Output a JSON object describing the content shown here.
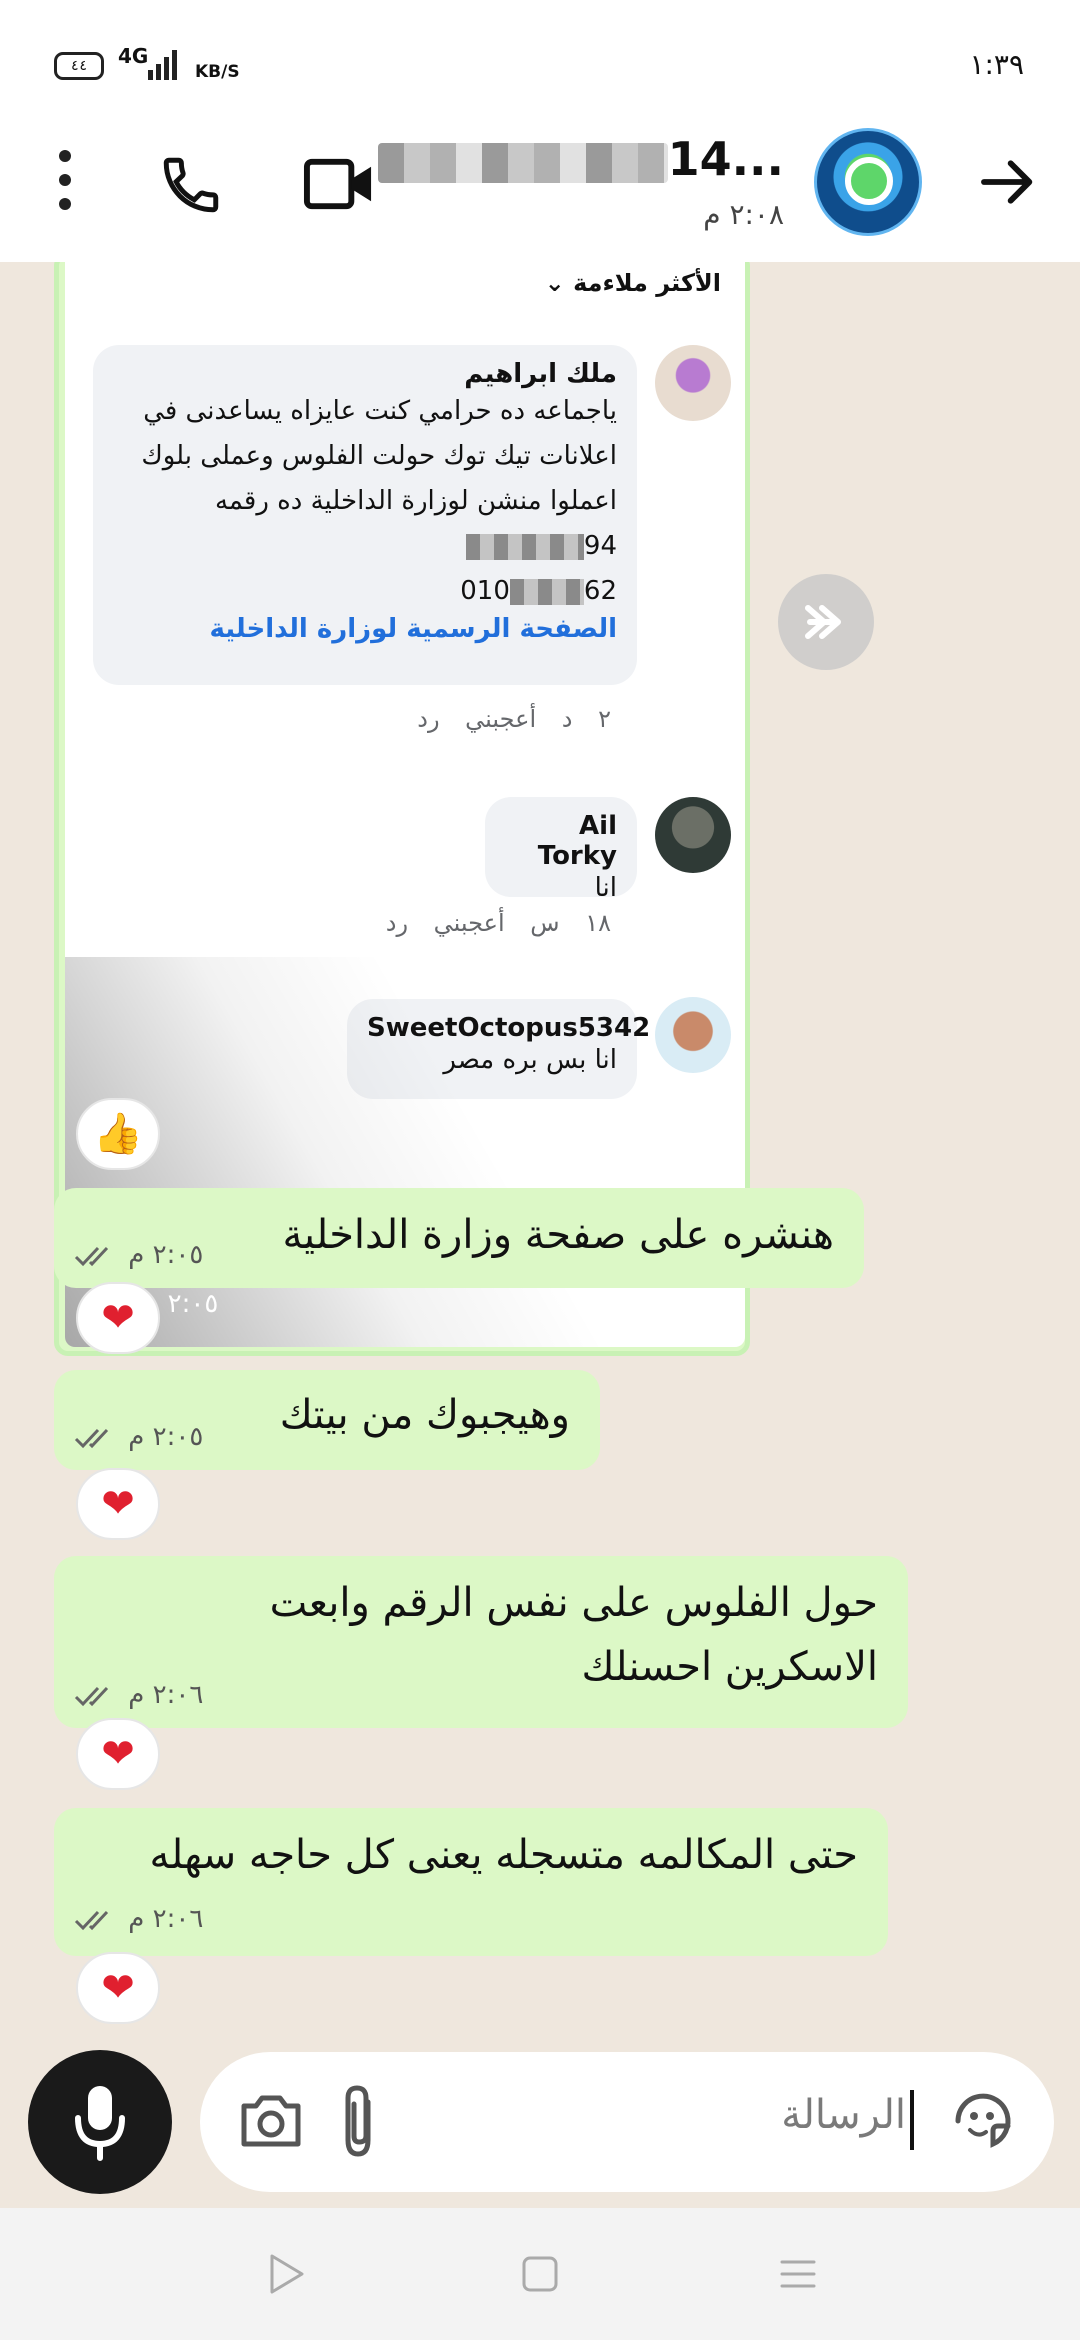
{
  "status_bar": {
    "time": "١:٣٩",
    "battery": "٤٤",
    "network": "4G",
    "speed_unit": "KB/S"
  },
  "header": {
    "contact_name_suffix": "14...",
    "status": "٢:٠٨ م",
    "icons": [
      "more-vert-icon",
      "phone-icon",
      "video-camera-icon",
      "arrow-right-icon"
    ]
  },
  "forwarded_card": {
    "sort_label": "الأكثر ملاءمة",
    "comments": [
      {
        "name": "ملك ابراهيم",
        "lines": [
          "ياجماعه ده حرامي كنت عايزاه يساعدنى في",
          "اعلانات تيك توك حولت الفلوس وعملى بلوك",
          "اعملوا منشن لوزارة الداخلية ده رقمه"
        ],
        "number1_suffix": "94",
        "number2_prefix": "010",
        "number2_suffix": "62",
        "link": "الصفحة الرسمية لوزارة الداخلية",
        "time": "٢ د",
        "like": "أعجبني",
        "reply": "رد"
      },
      {
        "name": "Ail Torky",
        "text": "انا",
        "time": "١٨ س",
        "like": "أعجبني",
        "reply": "رد"
      },
      {
        "name": "SweetOctopus5342",
        "text": "انا بس بره مصر"
      }
    ],
    "time": "٢:٠٥ م",
    "reaction": "👍"
  },
  "messages": [
    {
      "text": "هنشره على صفحة وزارة الداخلية",
      "time": "٢:٠٥ م",
      "reaction": "❤"
    },
    {
      "text": "وهيجبوك من بيتك",
      "time": "٢:٠٥ م",
      "reaction": "❤"
    },
    {
      "line1": "حول الفلوس على نفس الرقم وابعت",
      "line2": "الاسكرين احسنلك",
      "time": "٢:٠٦ م",
      "reaction": "❤"
    },
    {
      "text": "حتى المكالمه متسجله يعنى كل حاجه سهله",
      "time": "٢:٠٦ م",
      "reaction": "❤"
    }
  ],
  "input": {
    "placeholder": "الرسالة"
  },
  "colors": {
    "bubble_outgoing": "#dcf8c6",
    "chat_background": "#efe7dd",
    "link_blue": "#216fdb",
    "heart_red": "#e0202f"
  }
}
